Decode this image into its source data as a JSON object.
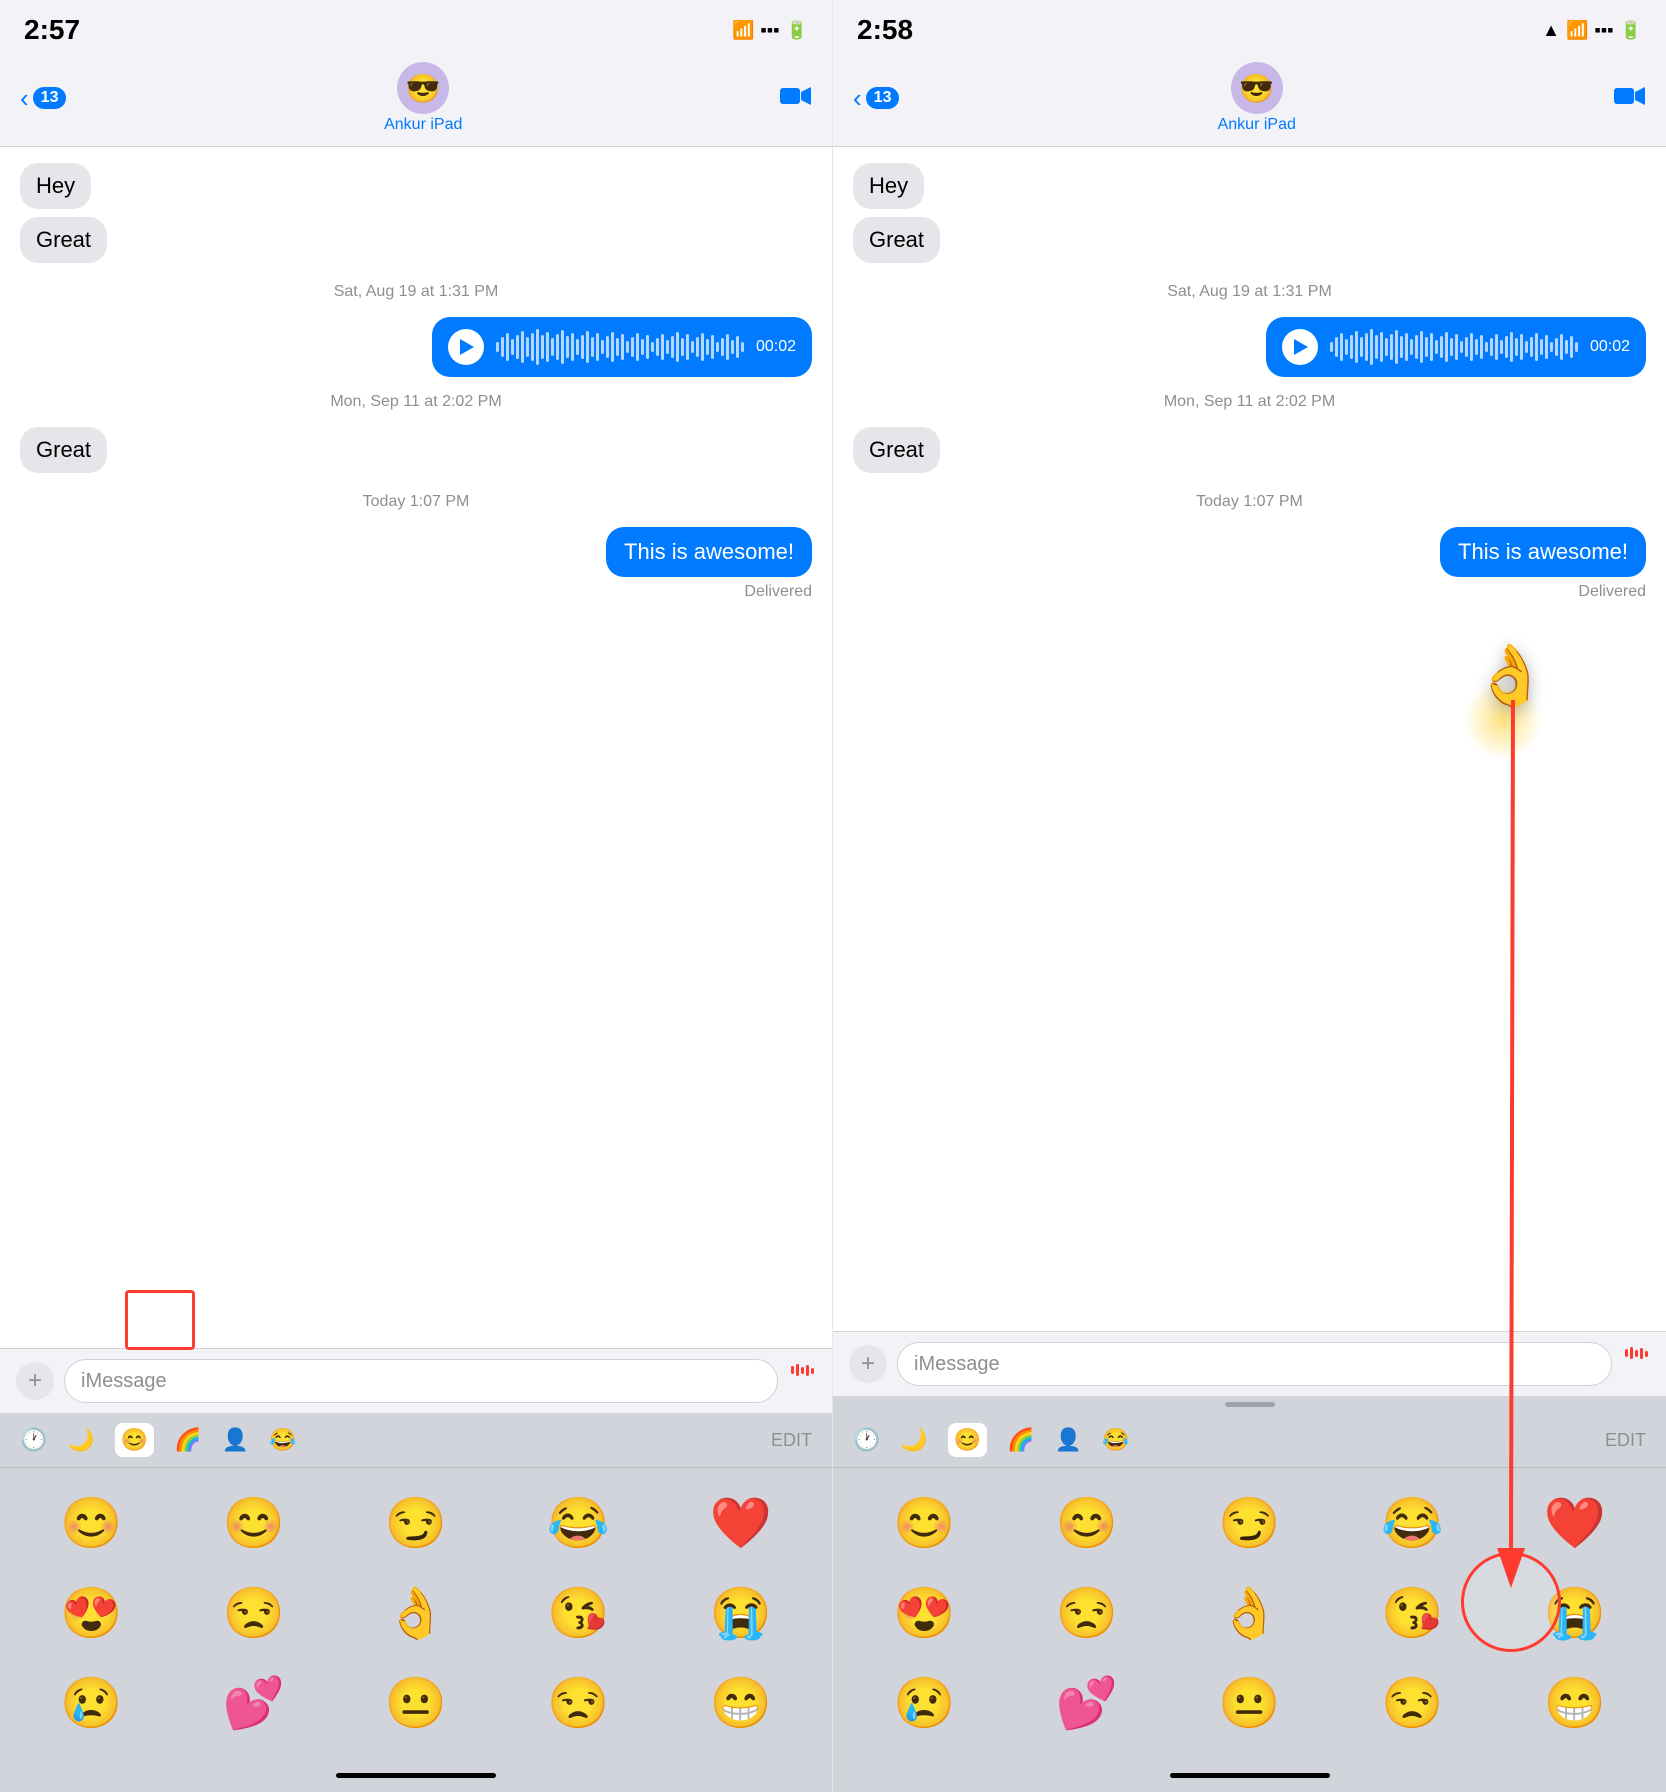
{
  "panels": {
    "left": {
      "status": {
        "time": "2:57",
        "location_arrow": false
      },
      "contact": "Ankur iPad",
      "back_count": "13",
      "messages": [
        {
          "type": "received",
          "text": "Hey"
        },
        {
          "type": "received",
          "text": "Great"
        },
        {
          "type": "timestamp",
          "text": "Sat, Aug 19 at 1:31 PM"
        },
        {
          "type": "audio",
          "duration": "00:02"
        },
        {
          "type": "timestamp",
          "text": "Mon, Sep 11 at 2:02 PM"
        },
        {
          "type": "received",
          "text": "Great"
        },
        {
          "type": "timestamp",
          "text": "Today 1:07 PM"
        },
        {
          "type": "sent",
          "text": "This is awesome!"
        },
        {
          "type": "delivered",
          "text": "Delivered"
        }
      ],
      "input_placeholder": "iMessage",
      "emoji_tabs": [
        "🕐",
        "🌙",
        "😊",
        "🌈",
        "👤",
        "😂",
        "EDIT"
      ],
      "emoji_rows": [
        [
          "😊",
          "😊",
          "😏",
          "😂",
          "❤️"
        ],
        [
          "😍",
          "😒",
          "👌",
          "😘",
          "😭"
        ],
        [
          "😢",
          "💕",
          "😐",
          "😒",
          "😁"
        ]
      ]
    },
    "right": {
      "status": {
        "time": "2:58",
        "location_arrow": true
      },
      "contact": "Ankur iPad",
      "back_count": "13",
      "messages": [
        {
          "type": "received",
          "text": "Hey"
        },
        {
          "type": "received",
          "text": "Great"
        },
        {
          "type": "timestamp",
          "text": "Sat, Aug 19 at 1:31 PM"
        },
        {
          "type": "audio",
          "duration": "00:02"
        },
        {
          "type": "timestamp",
          "text": "Mon, Sep 11 at 2:02 PM"
        },
        {
          "type": "received",
          "text": "Great"
        },
        {
          "type": "timestamp",
          "text": "Today 1:07 PM"
        },
        {
          "type": "sent",
          "text": "This is awesome!"
        },
        {
          "type": "delivered",
          "text": "Delivered"
        }
      ],
      "input_placeholder": "iMessage",
      "emoji_tabs": [
        "🕐",
        "🌙",
        "😊",
        "🌈",
        "👤",
        "😂",
        "EDIT"
      ],
      "emoji_rows": [
        [
          "😊",
          "😊",
          "😏",
          "😂",
          "❤️"
        ],
        [
          "😍",
          "😒",
          "👌",
          "😘",
          "😭"
        ],
        [
          "😢",
          "💕",
          "😐",
          "😒",
          "😁"
        ]
      ]
    }
  }
}
